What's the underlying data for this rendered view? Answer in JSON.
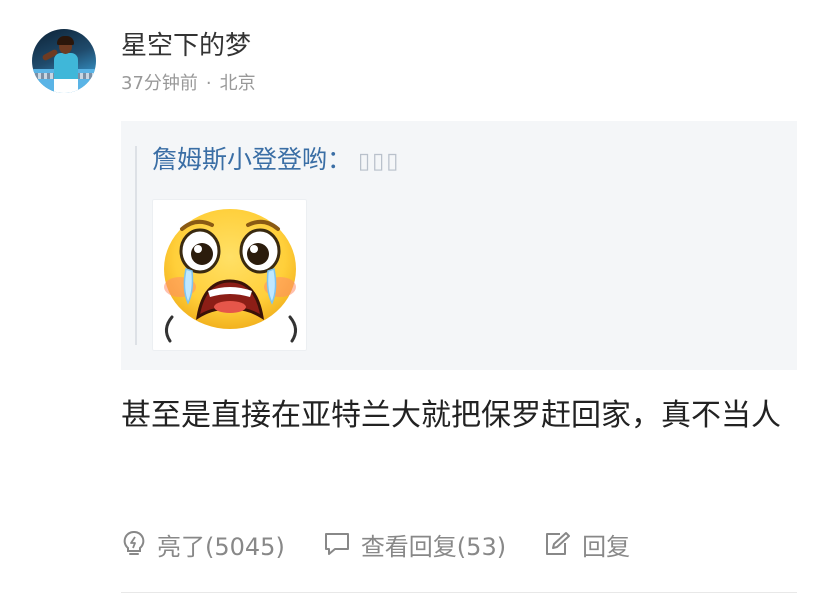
{
  "comment": {
    "username": "星空下的梦",
    "time": "37分钟前",
    "separator": "·",
    "location": "北京",
    "quote": {
      "author": "詹姆斯小登登哟",
      "colon": "：",
      "placeholder_glyphs": "▯▯▯",
      "image_icon": "crying-face-emoji"
    },
    "text": "甚至是直接在亚特兰大就把保罗赶回家，真不当人",
    "actions": {
      "like_label": "亮了(5045)",
      "like_icon": "lightbulb-icon",
      "view_replies_label": "查看回复(53)",
      "view_replies_icon": "speech-bubble-icon",
      "reply_label": "回复",
      "reply_icon": "edit-icon"
    }
  }
}
